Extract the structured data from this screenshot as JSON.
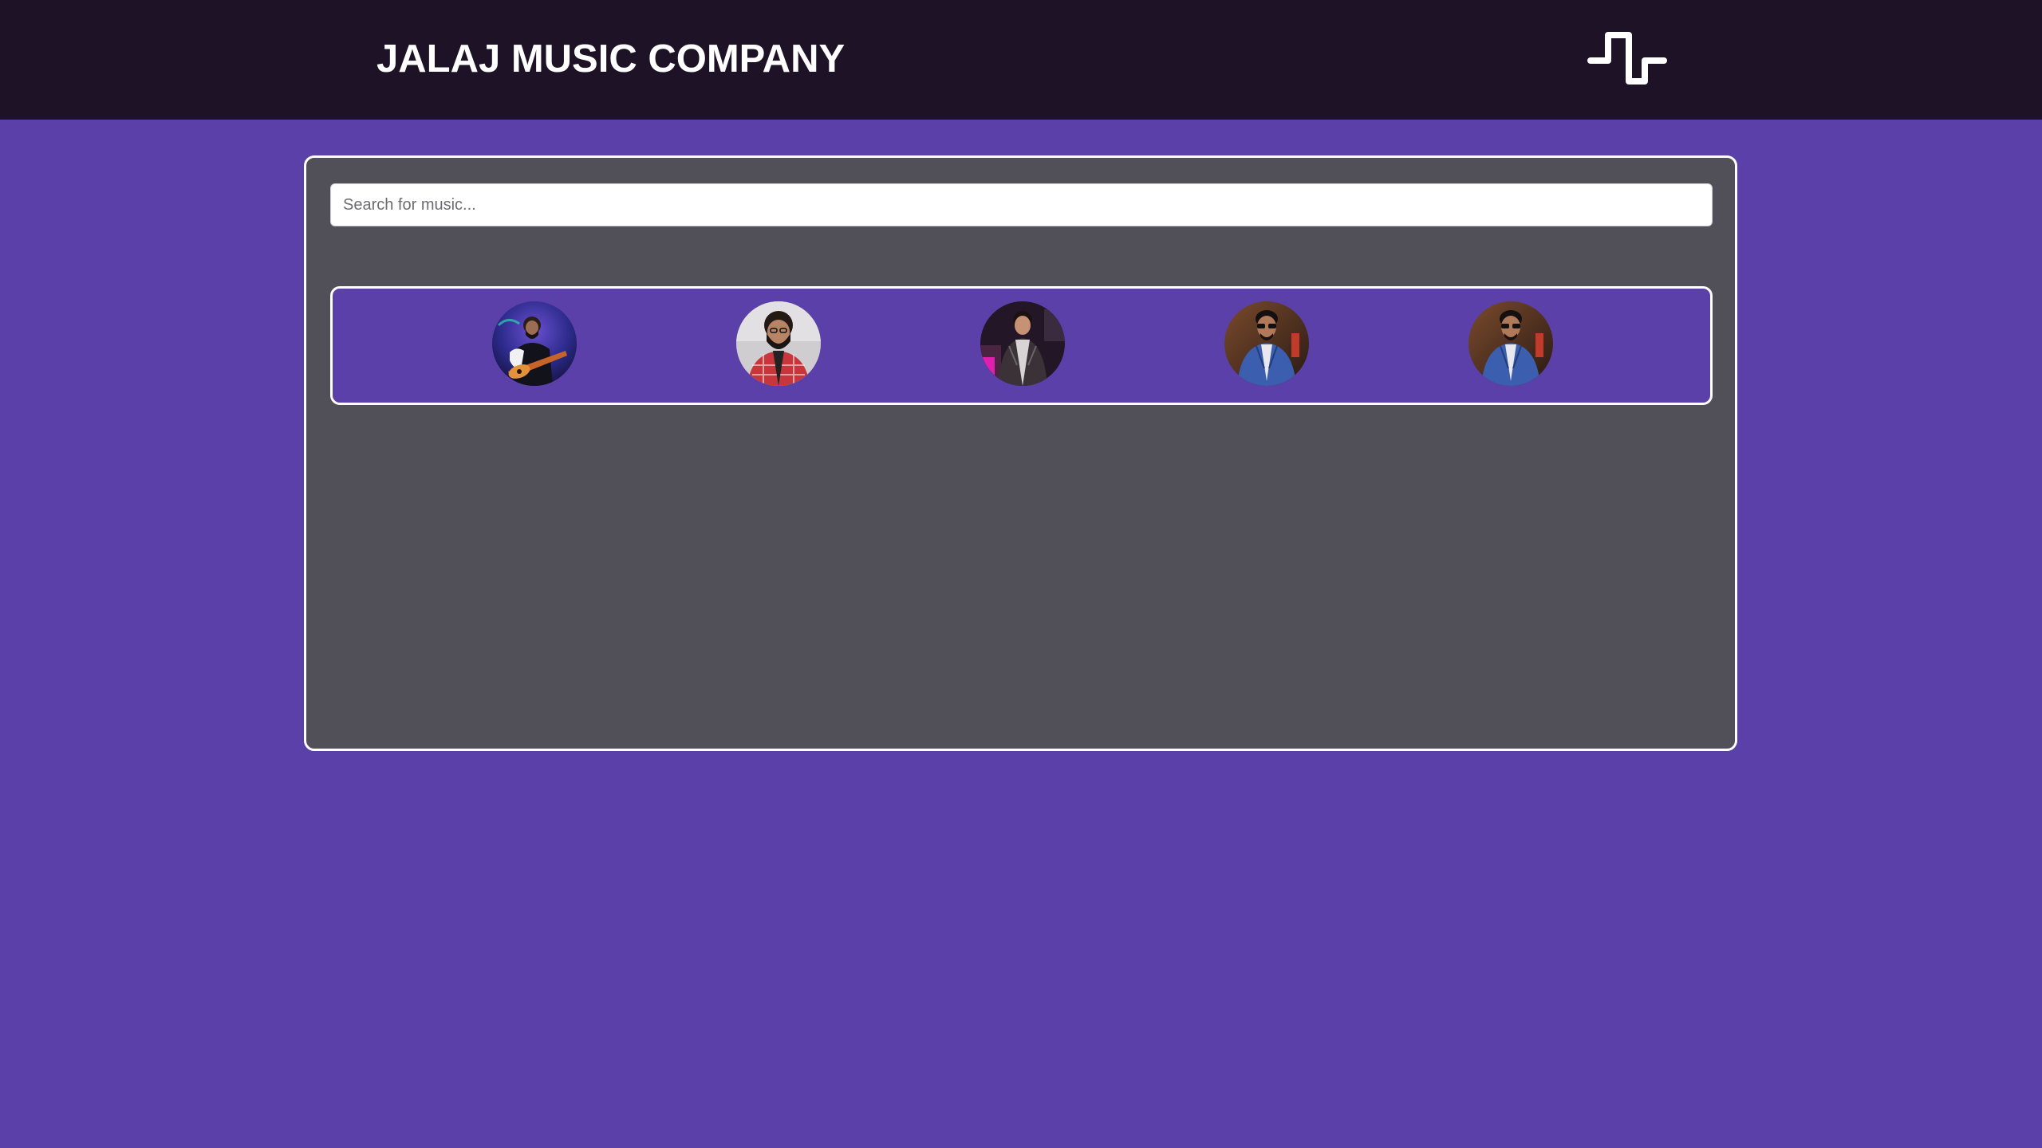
{
  "header": {
    "title": "JALAJ MUSIC COMPANY",
    "logo_icon": "pulse-wave-logo-icon"
  },
  "search": {
    "placeholder": "Search for music...",
    "value": ""
  },
  "artists": [
    {
      "icon": "artist-avatar-guitarist"
    },
    {
      "icon": "artist-avatar-bearded-plaid-shirt"
    },
    {
      "icon": "artist-avatar-leather-jacket"
    },
    {
      "icon": "artist-avatar-blue-suit-sunglasses"
    },
    {
      "icon": "artist-avatar-blue-suit-sunglasses"
    }
  ],
  "colors": {
    "page_background": "#5a40a8",
    "header_background": "#1d1226",
    "panel_background": "#515059",
    "border": "#ffffff"
  }
}
